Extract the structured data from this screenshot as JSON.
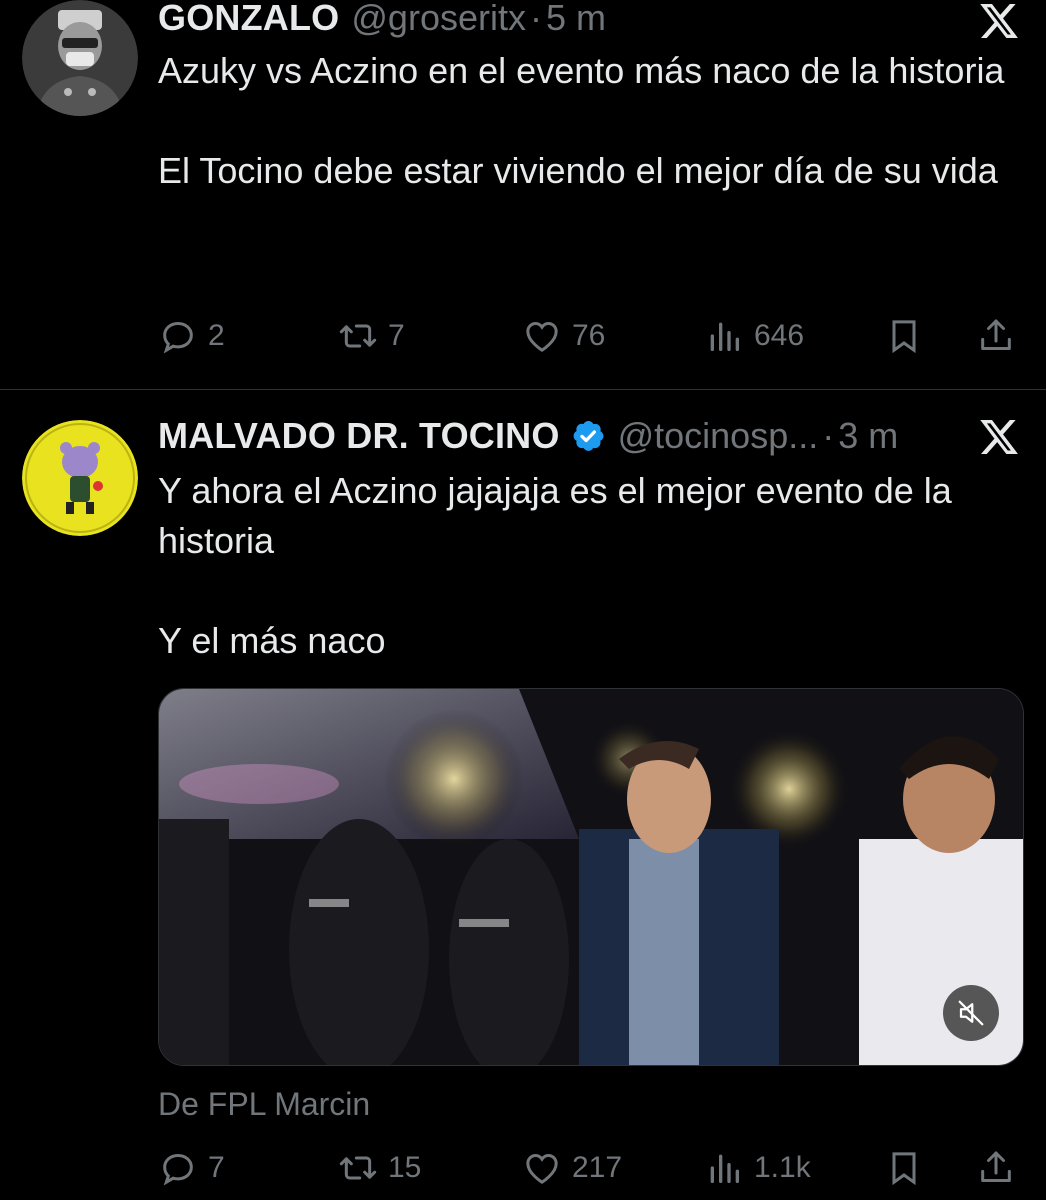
{
  "tweets": [
    {
      "name": "GONZALO",
      "handle": "@groseritx",
      "separator": "·",
      "time": "5 m",
      "text": [
        "Azuky vs Aczino en el evento más naco de la historia",
        "El Tocino debe estar viviendo el mejor día de su vida"
      ],
      "stats": {
        "replies": "2",
        "reposts": "7",
        "likes": "76",
        "views": "646"
      }
    },
    {
      "name": "MALVADO DR. TOCINO",
      "handle": "@tocinosp...",
      "separator": "·",
      "time": "3 m",
      "verified": true,
      "text": [
        "Y ahora el Aczino jajajaja es el mejor evento de la historia",
        "Y el más naco"
      ],
      "media_from": "De FPL Marcin",
      "stats": {
        "replies": "7",
        "reposts": "15",
        "likes": "217",
        "views": "1.1k"
      }
    }
  ],
  "icons": {
    "reply": "reply-icon",
    "repost": "repost-icon",
    "like": "heart-icon",
    "views": "views-icon",
    "bookmark": "bookmark-icon",
    "share": "share-icon",
    "x": "x-logo-icon",
    "mute": "mute-icon",
    "verified": "verified-badge-icon"
  },
  "colors": {
    "background": "#000000",
    "text": "#e7e9ea",
    "muted": "#71767b",
    "verified": "#1d9bf0"
  }
}
